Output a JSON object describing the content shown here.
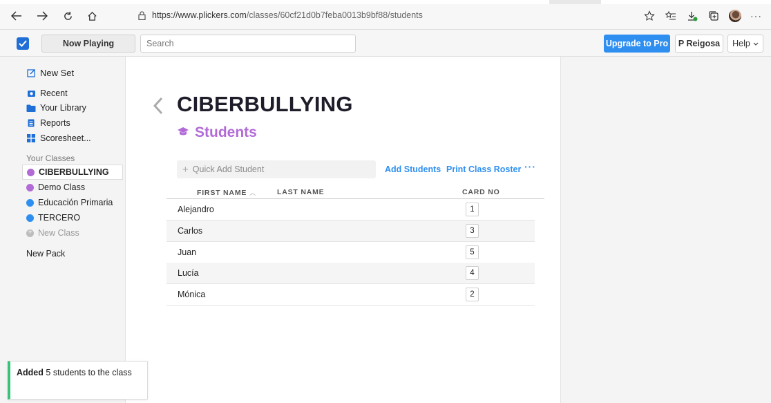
{
  "browser": {
    "url_host": "https://www.plickers.com",
    "url_path": "/classes/60cf21d0b7feba0013b9bf88/students"
  },
  "topbar": {
    "now_playing": "Now Playing",
    "search_placeholder": "Search",
    "upgrade": "Upgrade to Pro",
    "user": "P Reigosa",
    "help": "Help"
  },
  "sidebar": {
    "new_set": "New Set",
    "items": [
      {
        "label": "Recent",
        "icon": "recent-icon"
      },
      {
        "label": "Your Library",
        "icon": "folder-icon"
      },
      {
        "label": "Reports",
        "icon": "reports-icon"
      },
      {
        "label": "Scoresheet...",
        "icon": "grid-icon"
      }
    ],
    "section_label": "Your Classes",
    "classes": [
      {
        "label": "CIBERBULLYING",
        "color": "#b26bd6",
        "active": true
      },
      {
        "label": "Demo Class",
        "color": "#b26bd6"
      },
      {
        "label": "Educación Primaria",
        "color": "#2f8ff0"
      },
      {
        "label": "TERCERO",
        "color": "#2f8ff0"
      }
    ],
    "new_class": "New Class",
    "new_pack": "New Pack"
  },
  "main": {
    "title": "CIBERBULLYING",
    "subtitle": "Students",
    "quick_add_placeholder": "Quick Add Student",
    "add_students": "Add Students",
    "print_roster": "Print Class Roster",
    "more": "···",
    "columns": {
      "first": "FIRST NAME",
      "last": "LAST NAME",
      "card": "CARD NO"
    },
    "students": [
      {
        "first": "Alejandro",
        "last": "",
        "card": "1"
      },
      {
        "first": "Carlos",
        "last": "",
        "card": "3"
      },
      {
        "first": "Juan",
        "last": "",
        "card": "5"
      },
      {
        "first": "Lucía",
        "last": "",
        "card": "4"
      },
      {
        "first": "Mónica",
        "last": "",
        "card": "2"
      }
    ]
  },
  "toast": {
    "prefix": "Added",
    "count": "5",
    "suffix": "students to the class"
  },
  "colors": {
    "accent": "#2f8ff0",
    "purple": "#b26bd6",
    "success": "#39c27a"
  }
}
